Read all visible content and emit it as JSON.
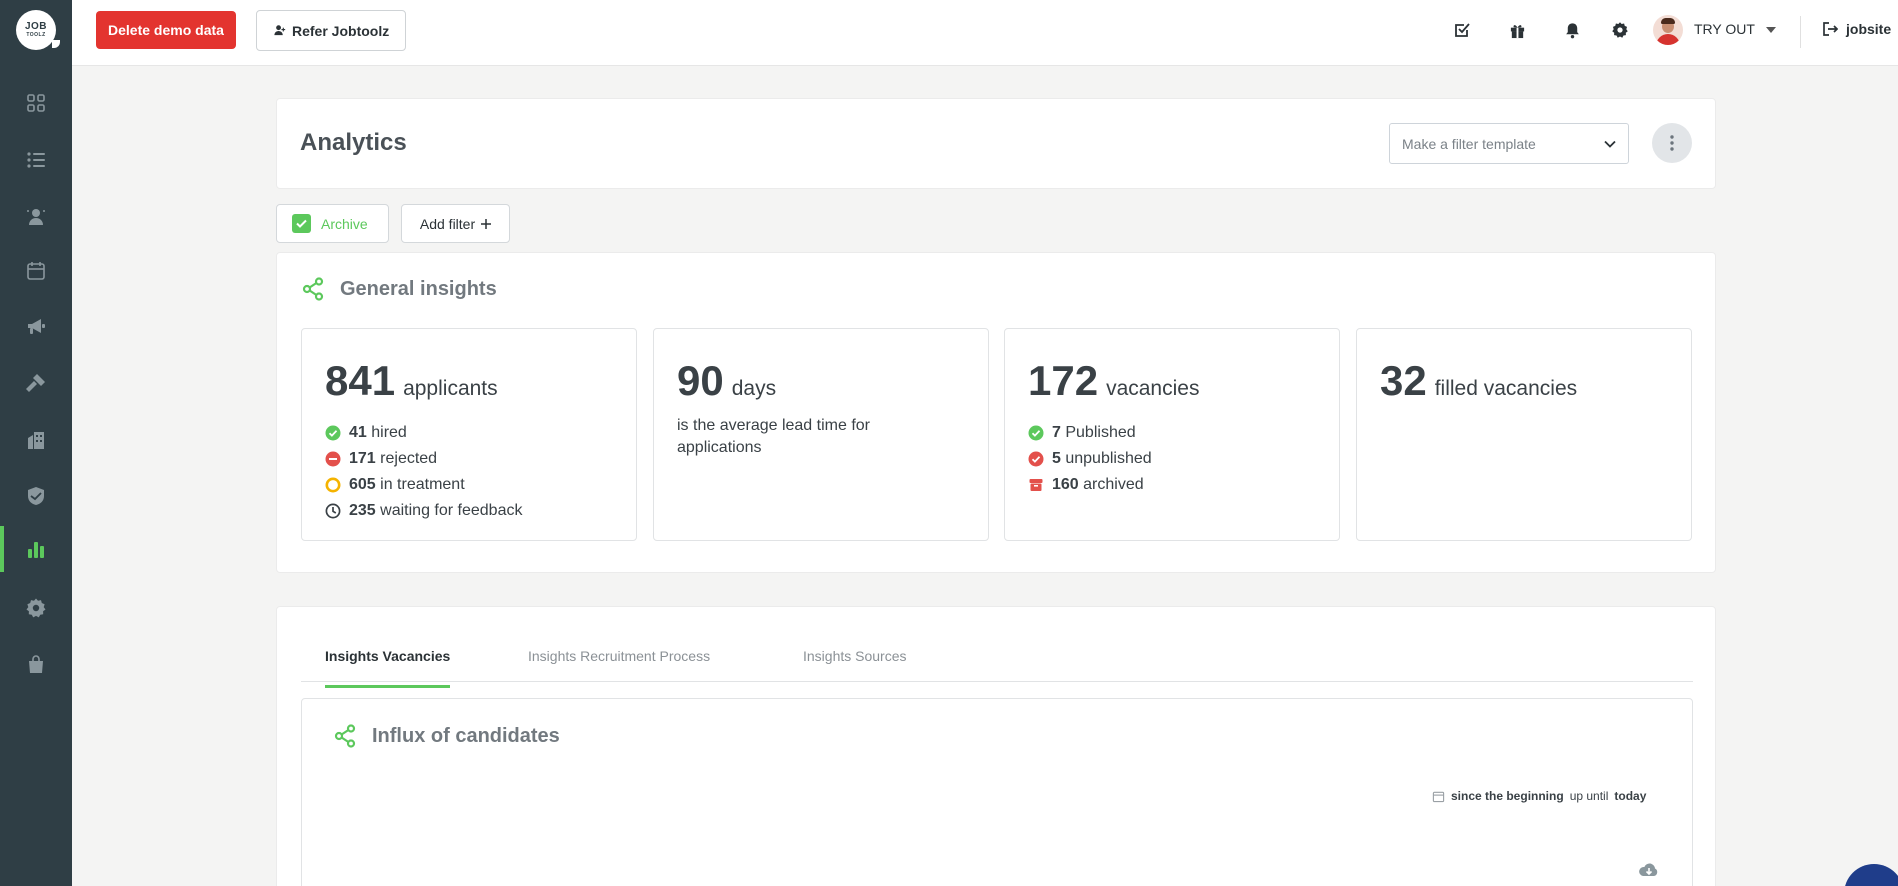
{
  "brand": {
    "logo_line1": "JOB",
    "logo_line2": "TOOLZ",
    "accent": "#5cc85c",
    "sidebar_bg": "#2f3e45",
    "danger": "#e3342f"
  },
  "sidebar": {
    "items": [
      {
        "name": "dashboard",
        "icon": "grid-icon"
      },
      {
        "name": "lists",
        "icon": "list-icon"
      },
      {
        "name": "candidates",
        "icon": "person-icon"
      },
      {
        "name": "calendar",
        "icon": "calendar-icon"
      },
      {
        "name": "marketing",
        "icon": "megaphone-icon"
      },
      {
        "name": "tools",
        "icon": "hammer-icon"
      },
      {
        "name": "companies",
        "icon": "building-icon"
      },
      {
        "name": "security",
        "icon": "shield-icon"
      },
      {
        "name": "analytics",
        "icon": "bar-chart-icon",
        "active": true
      },
      {
        "name": "settings",
        "icon": "gear-icon"
      },
      {
        "name": "shop",
        "icon": "shopping-bag-icon"
      }
    ]
  },
  "topbar": {
    "delete_demo_label": "Delete demo data",
    "refer_label": "Refer Jobtoolz",
    "user_label": "TRY OUT",
    "jobsite_label": "jobsite",
    "icons": [
      "tasks-icon",
      "gift-icon",
      "bell-icon",
      "gear-icon"
    ]
  },
  "header": {
    "title": "Analytics",
    "filter_template_placeholder": "Make a filter template"
  },
  "filters": {
    "archive_label": "Archive",
    "archive_checked": true,
    "add_filter_label": "Add filter"
  },
  "general_insights": {
    "title": "General insights",
    "applicants": {
      "value": "841",
      "unit": "applicants",
      "rows": [
        {
          "count": "41",
          "label": "hired",
          "icon": "check-circle-icon"
        },
        {
          "count": "171",
          "label": "rejected",
          "icon": "minus-circle-icon"
        },
        {
          "count": "605",
          "label": "in treatment",
          "icon": "ring-icon"
        },
        {
          "count": "235",
          "label": "waiting for feedback",
          "icon": "clock-icon"
        }
      ]
    },
    "lead_time": {
      "value": "90",
      "unit": "days",
      "description": "is the average lead time for applications"
    },
    "vacancies": {
      "value": "172",
      "unit": "vacancies",
      "rows": [
        {
          "count": "7",
          "label": "Published",
          "icon": "check-circle-icon"
        },
        {
          "count": "5",
          "label": "unpublished",
          "icon": "x-circle-icon"
        },
        {
          "count": "160",
          "label": "archived",
          "icon": "archive-icon"
        }
      ]
    },
    "filled": {
      "value": "32",
      "unit": "filled vacancies"
    }
  },
  "tabs": {
    "items": [
      "Insights Vacancies",
      "Insights Recruitment Process",
      "Insights Sources"
    ],
    "active": "Insights Vacancies"
  },
  "influx": {
    "title": "Influx of candidates",
    "range_start": "since the beginning",
    "range_mid": "up until",
    "range_end": "today"
  }
}
